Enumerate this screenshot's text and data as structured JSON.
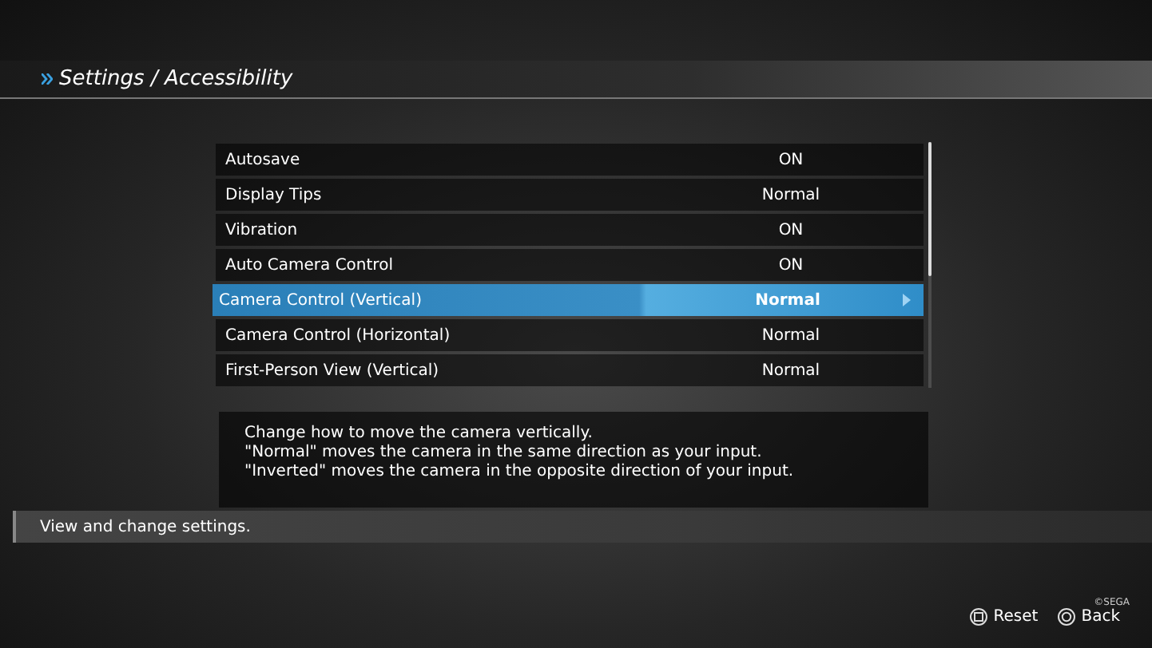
{
  "header": {
    "title": "Settings / Accessibility"
  },
  "settings": [
    {
      "label": "Autosave",
      "value": "ON",
      "selected": false
    },
    {
      "label": "Display Tips",
      "value": "Normal",
      "selected": false
    },
    {
      "label": "Vibration",
      "value": "ON",
      "selected": false
    },
    {
      "label": "Auto Camera Control",
      "value": "ON",
      "selected": false
    },
    {
      "label": "Camera Control (Vertical)",
      "value": "Normal",
      "selected": true
    },
    {
      "label": "Camera Control (Horizontal)",
      "value": "Normal",
      "selected": false
    },
    {
      "label": "First-Person View (Vertical)",
      "value": "Normal",
      "selected": false
    }
  ],
  "description": [
    "Change how to move the camera vertically.",
    "\"Normal\" moves the camera in the same direction as your input.",
    "\"Inverted\" moves the camera in the opposite direction of your input."
  ],
  "help_bar": "View and change settings.",
  "footer_buttons": [
    {
      "kind": "square",
      "label": "Reset"
    },
    {
      "kind": "circle",
      "label": "Back"
    }
  ],
  "copyright": "©SEGA"
}
